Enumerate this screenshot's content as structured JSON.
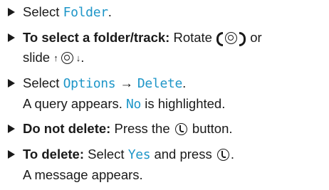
{
  "steps": [
    {
      "select_prefix": "Select ",
      "select_item": "Folder",
      "period": "."
    },
    {
      "label": "To select a folder/track:",
      "rotate_text": " Rotate ",
      "or_text": " or",
      "slide_text": "slide ",
      "period": "."
    },
    {
      "select_prefix": "Select ",
      "menu": "Options",
      "arrow": "→",
      "item": "Delete",
      "period": ".",
      "line2_prefix": "A query appears. ",
      "highlighted": "No",
      "line2_suffix": " is highlighted."
    },
    {
      "label": "Do not delete:",
      "text_before": " Press the ",
      "text_after": " button."
    },
    {
      "label": "To delete:",
      "text_select": " Select ",
      "item": "Yes",
      "text_press": " and press ",
      "period": ".",
      "line2": "A message appears."
    }
  ],
  "icons": {
    "bullet": "triangle-bullet-icon",
    "rotate_left": "rotate-left-bracket-icon",
    "controller": "controller-knob-icon",
    "rotate_right": "rotate-right-bracket-icon",
    "slide_up": "slide-up-arrow-icon",
    "slide_down": "slide-down-arrow-icon",
    "press": "press-button-icon"
  },
  "colors": {
    "display_text": "#1e96c8",
    "body_text": "#1a1a1a"
  }
}
